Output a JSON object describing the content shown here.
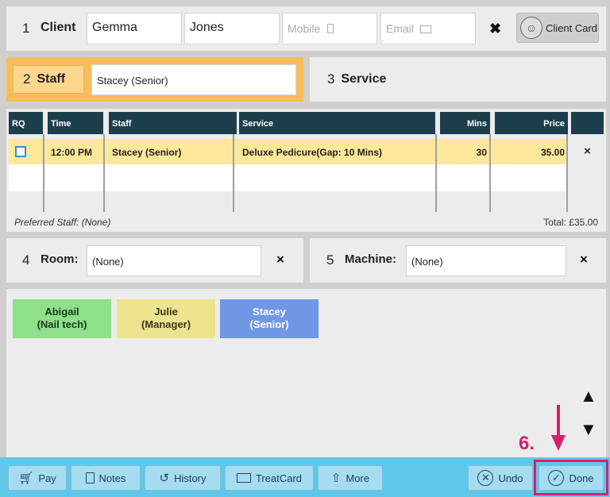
{
  "client": {
    "number": "1",
    "label": "Client",
    "first_name": "Gemma",
    "last_name": "Jones",
    "mobile_placeholder": "Mobile",
    "email_placeholder": "Email",
    "clear_label": "✖",
    "client_card_label": "Client Card"
  },
  "staff": {
    "number": "2",
    "label": "Staff",
    "value": "Stacey (Senior)"
  },
  "service": {
    "number": "3",
    "label": "Service"
  },
  "table": {
    "headers": [
      "RQ",
      "Time",
      "Staff",
      "Service",
      "Mins",
      "Price"
    ],
    "rows": [
      {
        "time": "12:00 PM",
        "staff": "Stacey (Senior)",
        "service": "Deluxe Pedicure(Gap: 10 Mins)",
        "mins": "30",
        "price": "35.00",
        "remove": "×"
      }
    ],
    "preferred_staff": "Preferred Staff:  (None)",
    "total": "Total: £35.00"
  },
  "room": {
    "number": "4",
    "label": "Room:",
    "value": "(None)",
    "clear": "×"
  },
  "machine": {
    "number": "5",
    "label": "Machine:",
    "value": "(None)",
    "clear": "×"
  },
  "staff_options": [
    {
      "line1": "Abigail",
      "line2": "(Nail tech)",
      "color": "#8ee08a",
      "text_color": "#1b3a1b"
    },
    {
      "line1": "Julie",
      "line2": "(Manager)",
      "color": "#eee38e",
      "text_color": "#3a361b"
    },
    {
      "line1": "Stacey",
      "line2": "(Senior)",
      "color": "#6f97e6",
      "text_color": "#ffffff"
    }
  ],
  "scroll": {
    "up": "▲",
    "down": "▼"
  },
  "toolbar": {
    "pay": "Pay",
    "notes": "Notes",
    "history": "History",
    "treatcard": "TreatCard",
    "more": "More",
    "undo": "Undo",
    "done": "Done"
  },
  "annotation": {
    "step": "6."
  },
  "colors": {
    "accent_orange": "#f7bd5a",
    "header_dark": "#1c3e4c",
    "row_highlight": "#fde89a",
    "toolbar_blue": "#5fc8ea",
    "annotation_pink": "#d81e6f"
  }
}
